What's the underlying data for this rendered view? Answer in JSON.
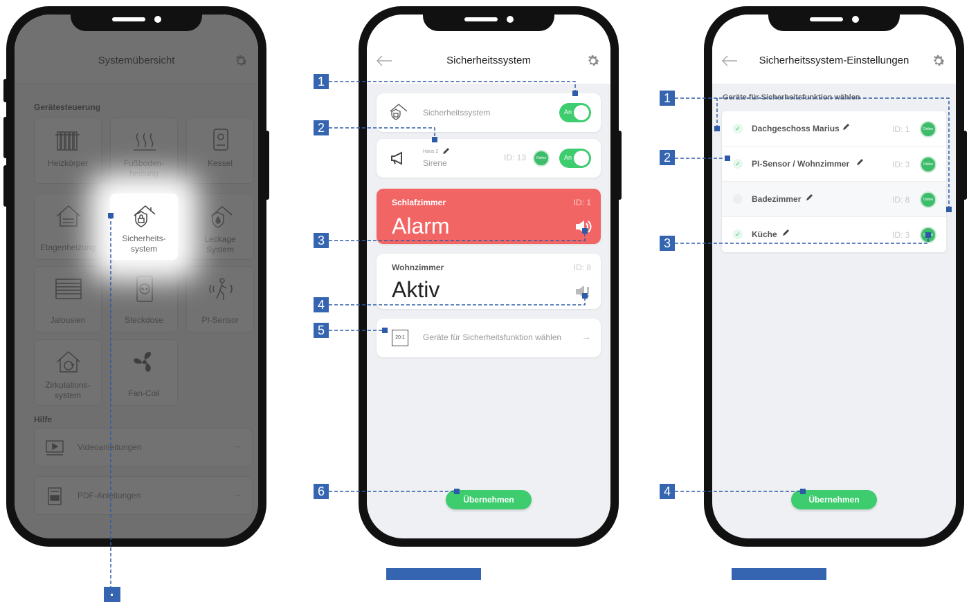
{
  "phone1": {
    "title": "Systemübersicht",
    "section_devices": "Gerätesteuerung",
    "tiles": [
      {
        "label": "Heizkörper",
        "icon": "radiator-icon"
      },
      {
        "label": "Fußboden-\nheizung",
        "icon": "floor-heating-icon"
      },
      {
        "label": "Kessel",
        "icon": "boiler-icon"
      },
      {
        "label": "Etagenheizung",
        "icon": "house-icon"
      },
      {
        "label": "Sicherheits-\nsystem",
        "icon": "security-house-icon"
      },
      {
        "label": "Leckage\nSystem",
        "icon": "leak-house-icon"
      },
      {
        "label": "Jalousien",
        "icon": "blinds-icon"
      },
      {
        "label": "Steckdose",
        "icon": "socket-icon"
      },
      {
        "label": "PI-Sensor",
        "icon": "motion-sensor-icon"
      },
      {
        "label": "Zirkulations-\nsystem",
        "icon": "circulation-house-icon"
      },
      {
        "label": "Fan-Coil",
        "icon": "fan-icon"
      }
    ],
    "section_help": "Hilfe",
    "help": [
      {
        "label": "Videoanleitungen",
        "icon": "video-icon"
      },
      {
        "label": "PDF-Anleitungen",
        "icon": "pdf-icon"
      }
    ]
  },
  "phone2": {
    "title": "Sicherheitssystem",
    "system_row": {
      "label": "Sicherheitssystem",
      "toggle": "An"
    },
    "siren_row": {
      "sub": "Haus 2",
      "label": "Sirene",
      "id": "ID: 13",
      "status": "Online",
      "toggle": "An"
    },
    "alarm_card": {
      "room": "Schlafzimmer",
      "id": "ID: 1",
      "state": "Alarm",
      "color": "#f26565"
    },
    "active_card": {
      "room": "Wohnzimmer",
      "id": "ID: 8",
      "state": "Aktiv"
    },
    "select_row": {
      "label": "Geräte für Sicherheitsfunktion wählen",
      "icon_text": "20:1"
    },
    "apply": "Übernehmen"
  },
  "phone3": {
    "title": "Sicherheitssystem-Einstellungen",
    "section": "Geräte für Sicherheitsfunktion wählen",
    "devices": [
      {
        "name": "Dachgeschoss Marius",
        "id": "ID: 1",
        "checked": true,
        "status": "Online"
      },
      {
        "name": "PI-Sensor / Wohnzimmer",
        "id": "ID: 3",
        "checked": true,
        "status": "Online"
      },
      {
        "name": "Badezimmer",
        "id": "ID: 8",
        "checked": false,
        "status": "Online"
      },
      {
        "name": "Küche",
        "id": "ID: 3",
        "checked": true,
        "status": "Online"
      }
    ],
    "apply": "Übernehmen"
  },
  "markers": {
    "m2_1": "1",
    "m2_2": "2",
    "m2_3": "3",
    "m2_4": "4",
    "m2_5": "5",
    "m2_6": "6",
    "m3_1": "1",
    "m3_2": "2",
    "m3_3": "3",
    "m3_4": "4"
  },
  "colors": {
    "accent_green": "#3dcc6e",
    "alarm_red": "#f26565",
    "marker_blue": "#3565b0"
  }
}
